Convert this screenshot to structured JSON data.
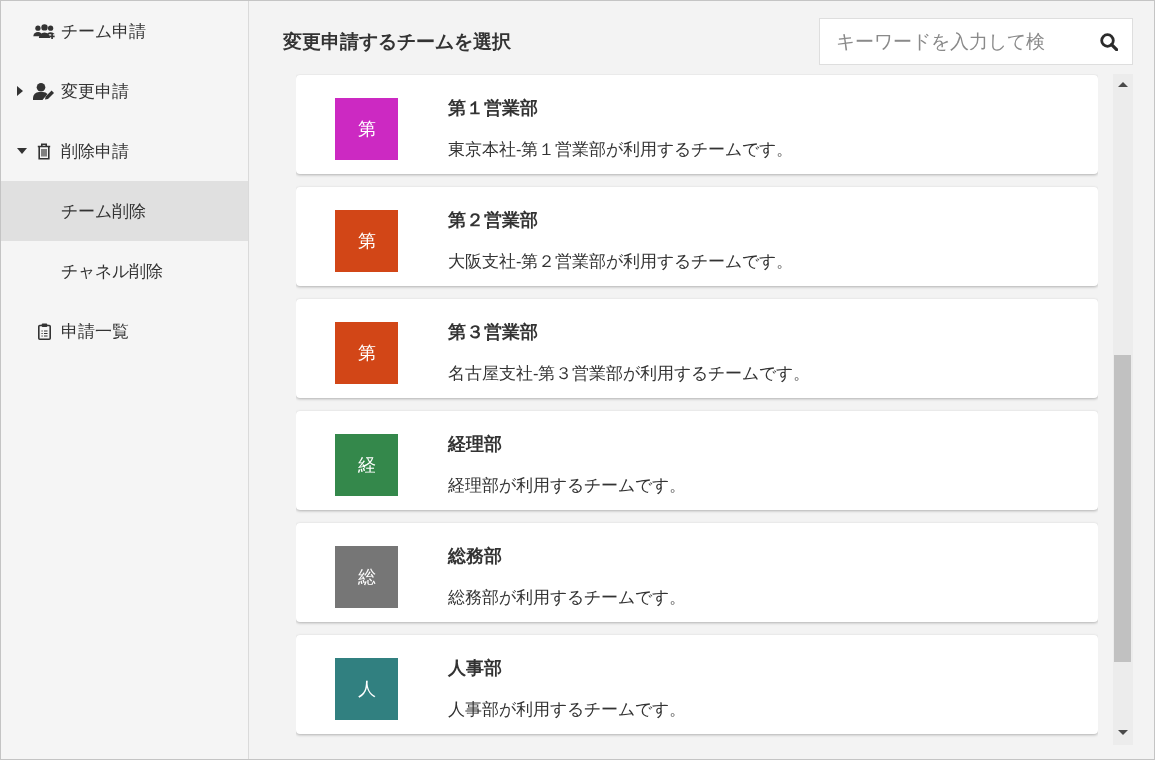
{
  "sidebar": {
    "items": [
      {
        "label": "チーム申請",
        "selected": false
      },
      {
        "label": "変更申請",
        "selected": false,
        "expanded": false
      },
      {
        "label": "削除申請",
        "selected": false,
        "expanded": true,
        "children": [
          {
            "label": "チーム削除",
            "selected": true
          },
          {
            "label": "チャネル削除",
            "selected": false
          }
        ]
      },
      {
        "label": "申請一覧",
        "selected": false
      }
    ]
  },
  "main": {
    "title": "変更申請するチームを選択",
    "search": {
      "placeholder": "キーワードを入力して検"
    },
    "teams": [
      {
        "initial": "第",
        "color": "#cc29c2",
        "name": "第１営業部",
        "description": "東京本社-第１営業部が利用するチームです。"
      },
      {
        "initial": "第",
        "color": "#d24617",
        "name": "第２営業部",
        "description": "大阪支社-第２営業部が利用するチームです。"
      },
      {
        "initial": "第",
        "color": "#d24617",
        "name": "第３営業部",
        "description": "名古屋支社-第３営業部が利用するチームです。"
      },
      {
        "initial": "経",
        "color": "#34884b",
        "name": "経理部",
        "description": "経理部が利用するチームです。"
      },
      {
        "initial": "総",
        "color": "#767676",
        "name": "総務部",
        "description": "総務部が利用するチームです。"
      },
      {
        "initial": "人",
        "color": "#318080",
        "name": "人事部",
        "description": "人事部が利用するチームです。"
      }
    ]
  }
}
